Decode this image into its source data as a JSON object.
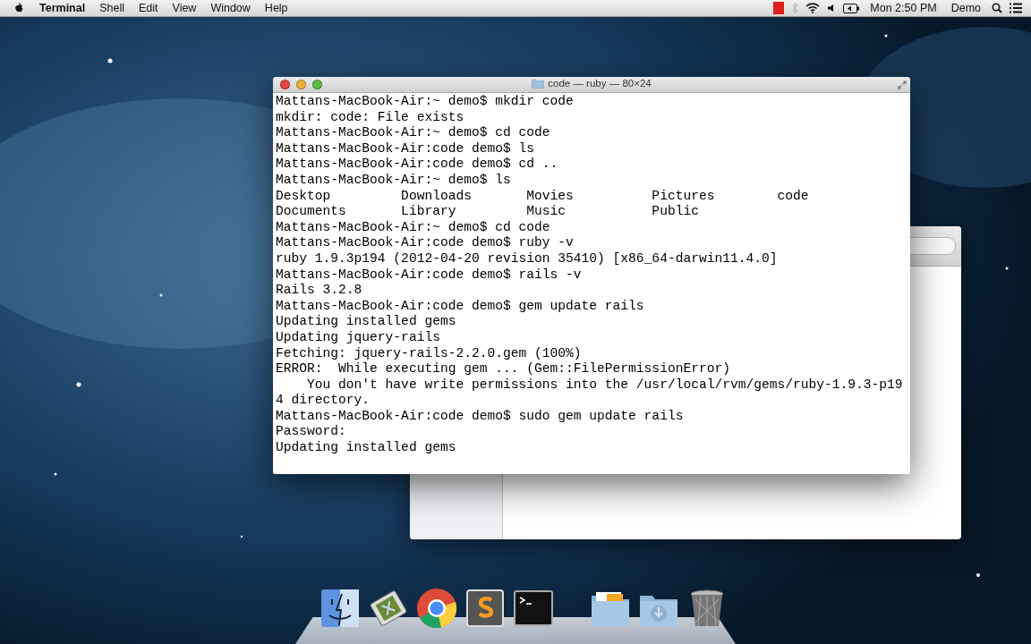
{
  "menu_bar": {
    "app_name": "Terminal",
    "menus": [
      "Shell",
      "Edit",
      "View",
      "Window",
      "Help"
    ],
    "clock": "Mon 2:50 PM",
    "user": "Demo"
  },
  "terminal": {
    "title": "code — ruby — 80×24",
    "lines": [
      "Mattans-MacBook-Air:~ demo$ mkdir code",
      "mkdir: code: File exists",
      "Mattans-MacBook-Air:~ demo$ cd code",
      "Mattans-MacBook-Air:code demo$ ls",
      "Mattans-MacBook-Air:code demo$ cd ..",
      "Mattans-MacBook-Air:~ demo$ ls",
      "Desktop         Downloads       Movies          Pictures        code",
      "Documents       Library         Music           Public",
      "Mattans-MacBook-Air:~ demo$ cd code",
      "Mattans-MacBook-Air:code demo$ ruby -v",
      "ruby 1.9.3p194 (2012-04-20 revision 35410) [x86_64-darwin11.4.0]",
      "Mattans-MacBook-Air:code demo$ rails -v",
      "Rails 3.2.8",
      "Mattans-MacBook-Air:code demo$ gem update rails",
      "Updating installed gems",
      "Updating jquery-rails",
      "Fetching: jquery-rails-2.2.0.gem (100%)",
      "ERROR:  While executing gem ... (Gem::FilePermissionError)",
      "    You don't have write permissions into the /usr/local/rvm/gems/ruby-1.9.3-p19",
      "4 directory.",
      "Mattans-MacBook-Air:code demo$ sudo gem update rails",
      "Password:",
      "Updating installed gems"
    ]
  }
}
